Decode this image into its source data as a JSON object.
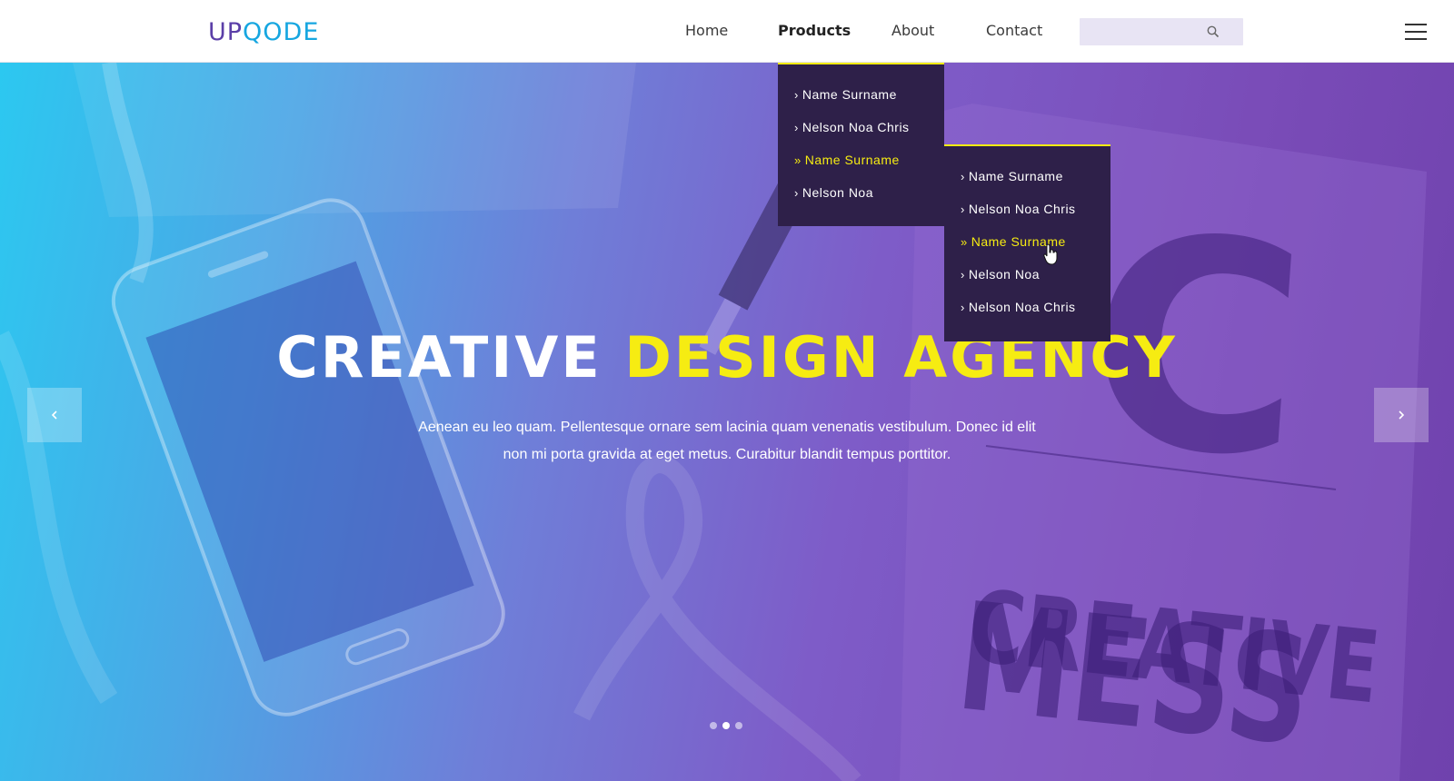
{
  "logo": {
    "part1": "UP",
    "part2": "QODE"
  },
  "nav": {
    "items": [
      "Home",
      "Products",
      "About",
      "Contact"
    ],
    "active": "Products"
  },
  "search": {
    "placeholder": "",
    "icon": "search-icon"
  },
  "menu_icon": "hamburger-icon",
  "hero": {
    "title_white": "CREATIVE",
    "title_accent": "DESIGN AGENCY",
    "text_line1": "Aenean eu leo quam. Pellentesque ornare sem lacinia quam venenatis vestibulum. Donec id elit",
    "text_line2": "non mi porta gravida at eget metus. Curabitur blandit tempus porttitor.",
    "prev_icon": "chevron-left-icon",
    "next_icon": "chevron-right-icon",
    "slides_count": 3,
    "active_slide": 2,
    "bg_text_top": "C",
    "bg_text_mid": "CREATIVE",
    "bg_text_bottom": "MESS"
  },
  "dropdown": {
    "items": [
      "Name Surname",
      "Nelson Noa Chris",
      "Name Surname",
      "Nelson Noa"
    ],
    "hovered_index": 2
  },
  "submenu": {
    "items": [
      "Name Surname",
      "Nelson Noa Chris",
      "Name Surname",
      "Nelson Noa",
      "Nelson Noa Chris"
    ],
    "hovered_index": 2
  },
  "colors": {
    "accent": "#f6ec12",
    "dropdown_bg": "#2e2049",
    "logo_purple": "#5b3fa8",
    "logo_blue": "#16a6e0"
  }
}
